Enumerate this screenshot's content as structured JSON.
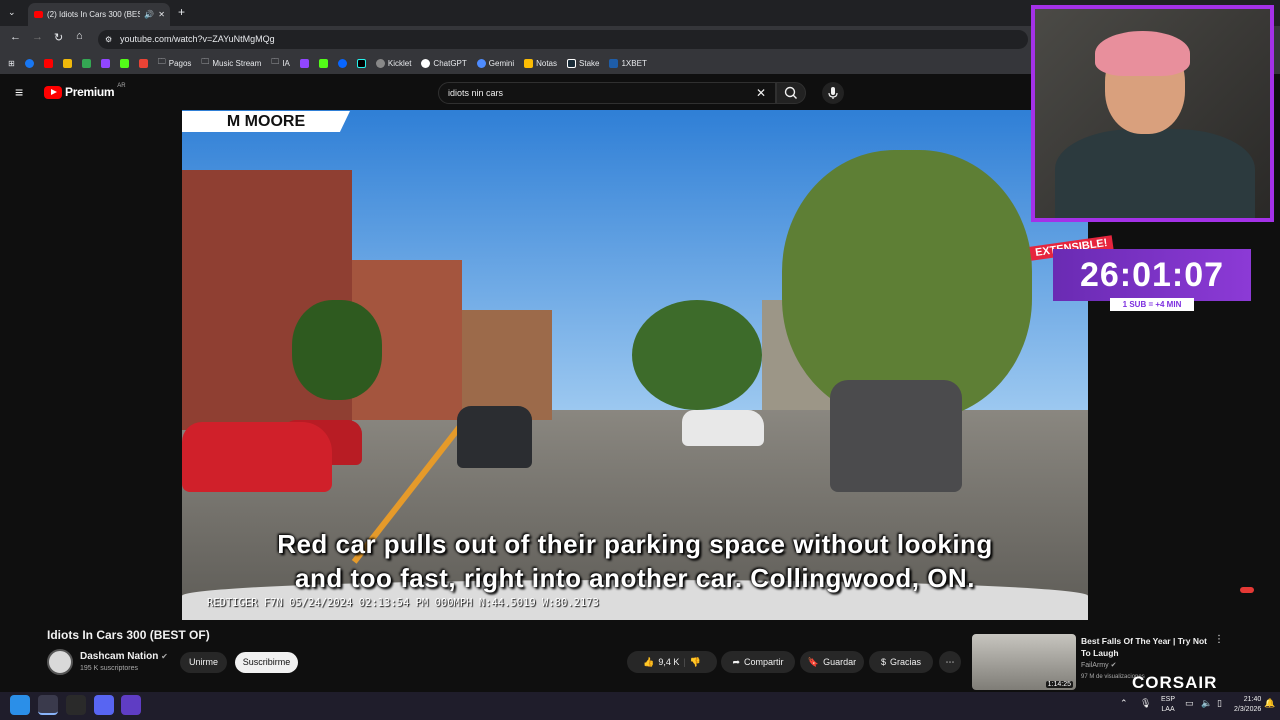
{
  "browser": {
    "tab_title": "(2) Idiots In Cars 300 (BEST",
    "url": "youtube.com/watch?v=ZAYuNtMgMQg",
    "bookmarks": [
      "Pagos",
      "Music Stream",
      "IA",
      "Kicklet",
      "ChatGPT",
      "Gemini",
      "Notas",
      "Stake",
      "1XBET"
    ]
  },
  "youtube": {
    "logo_text": "Premium",
    "logo_country": "AR",
    "search_value": "idiots nin cars"
  },
  "video": {
    "name_tag": "M MOORE",
    "caption_line1": "Red car pulls out of their parking space without looking",
    "caption_line2": "and too fast, right into another car. Collingwood, ON.",
    "dash_info": "REDTIGER F7N 05/24/2024 02:13:54 PM 000MPH N:44.5019 W:80.2173",
    "title": "Idiots In Cars 300 (BEST OF)"
  },
  "channel": {
    "name": "Dashcam Nation",
    "subscribers": "195 K suscriptores",
    "join_label": "Unirme",
    "subscribe_label": "Suscribirme"
  },
  "actions": {
    "likes": "9,4 K",
    "share": "Compartir",
    "save": "Guardar",
    "thanks": "Gracias"
  },
  "recommendation": {
    "title": "Best Falls Of The Year | Try Not To Laugh",
    "channel": "FailArmy",
    "views": "97 M de visualizaciones",
    "duration": "1:14:25"
  },
  "overlay": {
    "extensible": "EXTENSIBLE!",
    "timer": "26:01:07",
    "timer_rule": "1 SUB = +4 MIN",
    "brand": "CORSAIR"
  },
  "taskbar": {
    "lang_line1": "ESP",
    "lang_line2": "LAA",
    "time": "21:40",
    "date": "2/3/2026"
  },
  "colors": {
    "accent": "#a431e8",
    "yt_red": "#ff0000"
  }
}
